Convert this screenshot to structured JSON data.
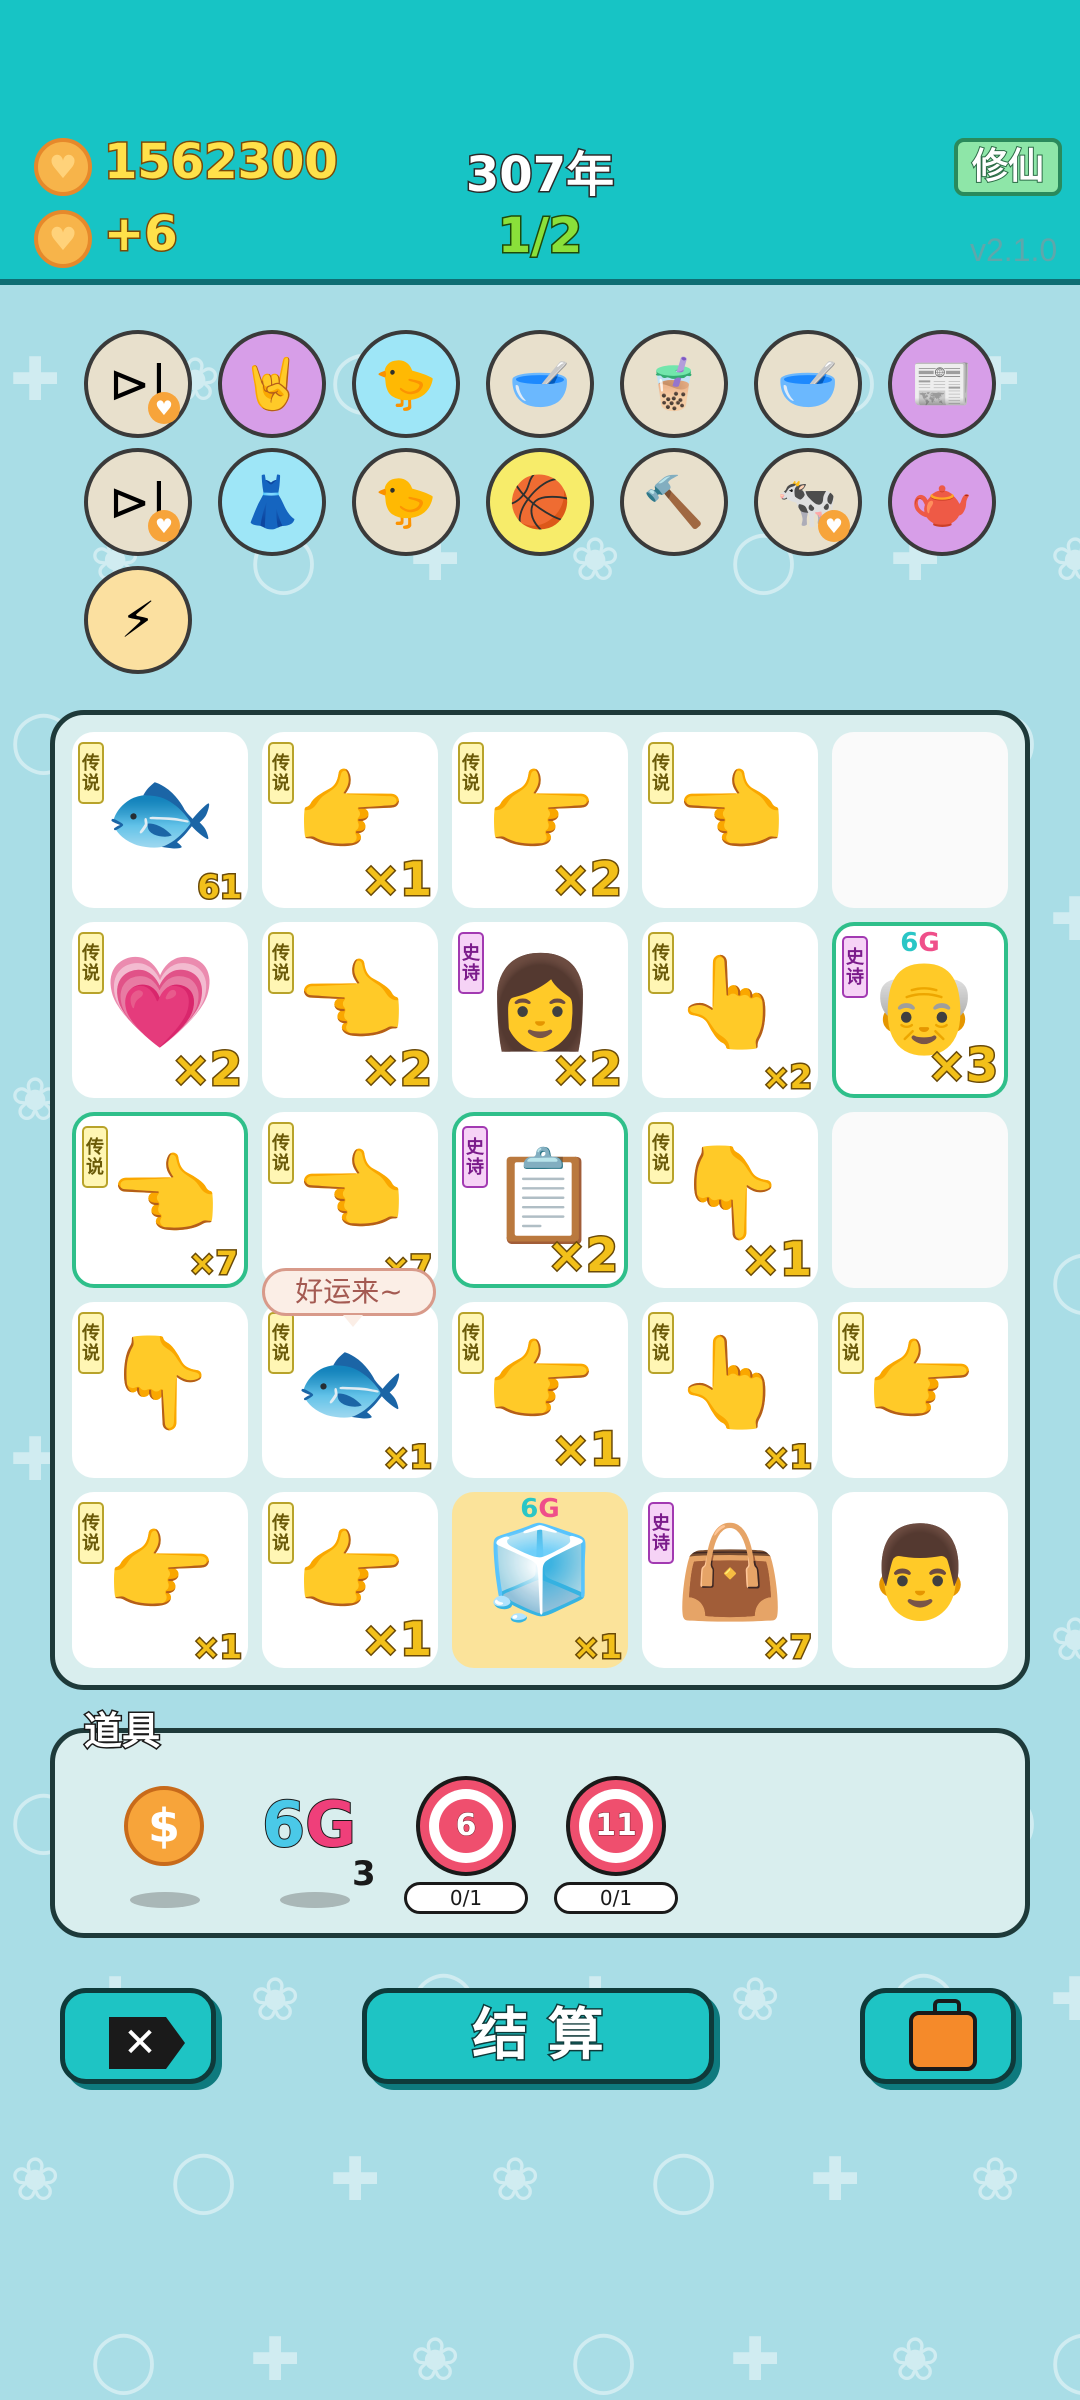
{
  "header": {
    "coins": "1562300",
    "income": "+6",
    "year": "307年",
    "round": "1/2",
    "mode_label": "修仙",
    "version": "v2.1.0"
  },
  "items_row1": [
    {
      "name": "skip",
      "glyph": "⊳|",
      "bg": "beige",
      "heart": true
    },
    {
      "name": "rock-hand",
      "glyph": "🤘",
      "bg": "purple"
    },
    {
      "name": "chick-egg",
      "glyph": "🐤",
      "bg": "blue"
    },
    {
      "name": "dog-bowl",
      "glyph": "🥣",
      "bg": "beige"
    },
    {
      "name": "bubble-tea",
      "glyph": "🧋",
      "bg": "beige"
    },
    {
      "name": "dog-bowl",
      "glyph": "🥣",
      "bg": "beige"
    },
    {
      "name": "time-magazine",
      "glyph": "📰",
      "bg": "purple"
    }
  ],
  "items_row2": [
    {
      "name": "skip",
      "glyph": "⊳|",
      "bg": "beige",
      "heart": true
    },
    {
      "name": "skirt",
      "glyph": "👗",
      "bg": "blue"
    },
    {
      "name": "chick-egg",
      "glyph": "🐤",
      "bg": "beige"
    },
    {
      "name": "basketballs",
      "glyph": "🏀",
      "bg": "yellow"
    },
    {
      "name": "hammer",
      "glyph": "🔨",
      "bg": "beige"
    },
    {
      "name": "cows",
      "glyph": "🐄",
      "bg": "beige",
      "heart": true
    },
    {
      "name": "gravy-boat",
      "glyph": "🫖",
      "bg": "purple"
    }
  ],
  "items_row3": [
    {
      "name": "lightning",
      "glyph": "⚡",
      "bg": "peach"
    }
  ],
  "board": [
    [
      {
        "badge": "传说",
        "type": "leg",
        "glyph": "🐟",
        "count": "61",
        "size": "small"
      },
      {
        "badge": "传说",
        "type": "leg",
        "glyph": "👉",
        "count": "×1",
        "size": "big"
      },
      {
        "badge": "传说",
        "type": "leg",
        "glyph": "👉",
        "count": "×2",
        "size": "big"
      },
      {
        "badge": "传说",
        "type": "leg",
        "glyph": "👈",
        "count": "",
        "size": "big"
      },
      {
        "empty": true
      }
    ],
    [
      {
        "badge": "传说",
        "type": "leg",
        "glyph": "💗",
        "count": "×2",
        "size": "big"
      },
      {
        "badge": "传说",
        "type": "leg",
        "glyph": "👈",
        "count": "×2",
        "size": "big"
      },
      {
        "badge": "史诗",
        "type": "epic",
        "glyph": "👩",
        "count": "×2",
        "size": "big"
      },
      {
        "badge": "传说",
        "type": "leg",
        "glyph": "👆",
        "count": "×2",
        "size": "small"
      },
      {
        "badge": "史诗",
        "type": "epic",
        "glyph": "👴",
        "count": "×3",
        "size": "big",
        "hl": true,
        "tag": "6G"
      }
    ],
    [
      {
        "badge": "传说",
        "type": "leg",
        "glyph": "👈",
        "count": "×7",
        "size": "small",
        "hl": true
      },
      {
        "badge": "传说",
        "type": "leg",
        "glyph": "👈",
        "count": "×7",
        "size": "small"
      },
      {
        "badge": "史诗",
        "type": "epic",
        "glyph": "📋",
        "count": "×2",
        "size": "big",
        "hl": true
      },
      {
        "badge": "传说",
        "type": "leg",
        "glyph": "👇",
        "count": "×1",
        "size": "big"
      },
      {
        "empty": true
      }
    ],
    [
      {
        "badge": "传说",
        "type": "leg",
        "glyph": "👇",
        "count": "",
        "size": "small"
      },
      {
        "badge": "传说",
        "type": "leg",
        "glyph": "🐟",
        "count": "×1",
        "size": "small"
      },
      {
        "badge": "传说",
        "type": "leg",
        "glyph": "👉",
        "count": "×1",
        "size": "big"
      },
      {
        "badge": "传说",
        "type": "leg",
        "glyph": "👆",
        "count": "×1",
        "size": "small"
      },
      {
        "badge": "传说",
        "type": "leg",
        "glyph": "👉",
        "count": "",
        "size": "small"
      }
    ],
    [
      {
        "badge": "传说",
        "type": "leg",
        "glyph": "👉",
        "count": "×1",
        "size": "small"
      },
      {
        "badge": "传说",
        "type": "leg",
        "glyph": "👉",
        "count": "×1",
        "size": "big"
      },
      {
        "glyph": "🧊",
        "count": "×1",
        "size": "small",
        "gold": true,
        "tag": "6G"
      },
      {
        "badge": "史诗",
        "type": "epic",
        "glyph": "👜",
        "count": "×7",
        "size": "small"
      },
      {
        "glyph": "👨",
        "count": "",
        "size": "small"
      }
    ]
  ],
  "bubble": "好运来~",
  "props": {
    "title": "道具",
    "dollar": "$",
    "six_g_digit": "6",
    "six_g_letter": "G",
    "six_g_count": "3",
    "targets": [
      {
        "value": "6",
        "progress": "0/1"
      },
      {
        "value": "11",
        "progress": "0/1"
      }
    ]
  },
  "buttons": {
    "close": "✕",
    "settle": "结 算",
    "bag": ""
  },
  "colors": {
    "header_bg": "#17c4c5",
    "body_bg": "#a9dde6",
    "accent_gold": "#ffe14a",
    "button_teal": "#1ec4c4"
  }
}
